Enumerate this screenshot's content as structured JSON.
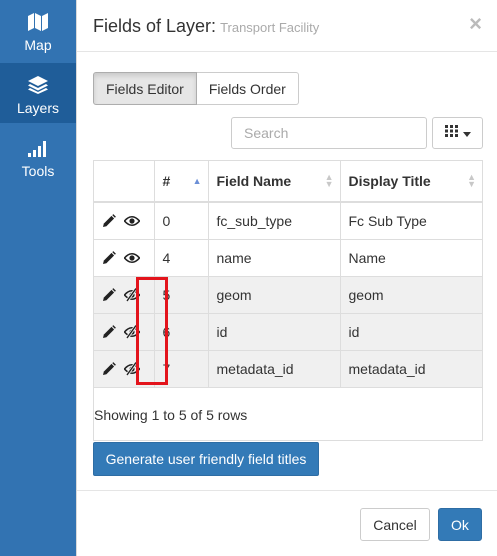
{
  "sidebar": {
    "items": [
      {
        "label": "Map",
        "icon": "map-icon"
      },
      {
        "label": "Layers",
        "icon": "layers-icon",
        "active": true
      },
      {
        "label": "Tools",
        "icon": "signal-bars-icon"
      }
    ]
  },
  "dialog": {
    "title": "Fields of Layer:",
    "subtitle": "Transport Facility",
    "close_symbol": "×"
  },
  "tabs": [
    {
      "label": "Fields Editor",
      "active": true
    },
    {
      "label": "Fields Order",
      "active": false
    }
  ],
  "search": {
    "placeholder": "Search",
    "value": ""
  },
  "columns_button": {
    "icon": "grid-icon",
    "caret": "caret-down-icon"
  },
  "table": {
    "headers": [
      "",
      "#",
      "Field Name",
      "Display Title"
    ],
    "rows": [
      {
        "num": "0",
        "field": "fc_sub_type",
        "title": "Fc Sub Type",
        "visible": true
      },
      {
        "num": "4",
        "field": "name",
        "title": "Name",
        "visible": true
      },
      {
        "num": "5",
        "field": "geom",
        "title": "geom",
        "visible": false
      },
      {
        "num": "6",
        "field": "id",
        "title": "id",
        "visible": false
      },
      {
        "num": "7",
        "field": "metadata_id",
        "title": "metadata_id",
        "visible": false
      }
    ],
    "showing": "Showing 1 to 5 of 5 rows"
  },
  "generate_button": "Generate user friendly field titles",
  "footer": {
    "cancel": "Cancel",
    "ok": "Ok"
  },
  "colors": {
    "sidebar": "#3273b2",
    "sidebar_active": "#1f5d99",
    "primary": "#337ab7",
    "highlight": "#e3141c"
  }
}
